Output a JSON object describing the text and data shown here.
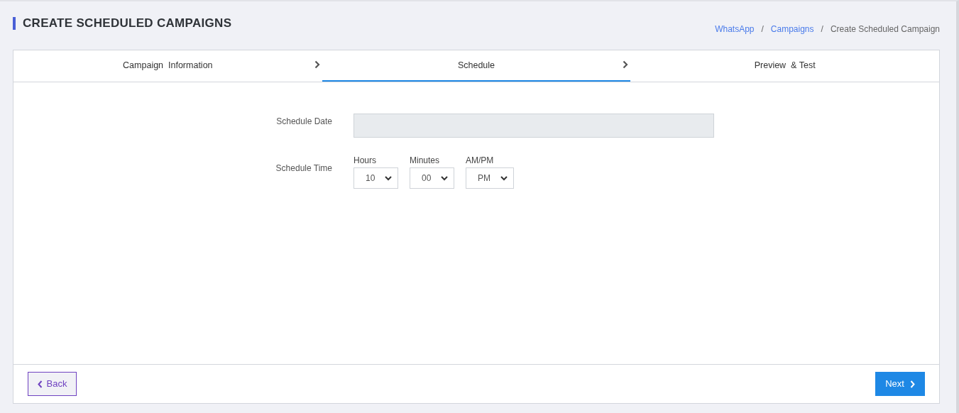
{
  "page_title": "CREATE SCHEDULED CAMPAIGNS",
  "breadcrumb": [
    {
      "label": "WhatsApp",
      "current": false
    },
    {
      "label": "Campaigns",
      "current": false
    },
    {
      "label": "Create Scheduled Campaign",
      "current": true
    }
  ],
  "separator": "/",
  "tabs": [
    {
      "label": "Campaign  Information",
      "selected": false
    },
    {
      "label": "Schedule",
      "selected": true
    },
    {
      "label": "Preview  & Test",
      "selected": false
    }
  ],
  "schedule_date": {
    "label": "Schedule Date",
    "disabled": true
  },
  "schedule_time": {
    "label": "Schedule Time",
    "selects": [
      {
        "label": "Hours",
        "value": "10"
      },
      {
        "label": "Minutes",
        "value": "00"
      },
      {
        "label": "AM/PM",
        "value": "PM"
      }
    ]
  },
  "buttons": [
    {
      "kind": "back",
      "label": "Back"
    },
    {
      "kind": "next",
      "label": "Next"
    }
  ]
}
